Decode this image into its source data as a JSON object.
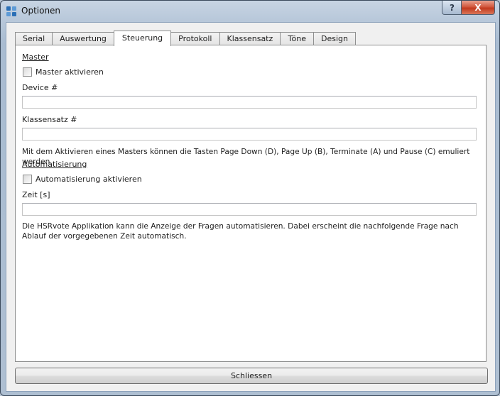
{
  "window": {
    "title": "Optionen",
    "help_symbol": "?",
    "close_symbol": "X"
  },
  "tabs": [
    {
      "label": "Serial"
    },
    {
      "label": "Auswertung"
    },
    {
      "label": "Steuerung"
    },
    {
      "label": "Protokoll"
    },
    {
      "label": "Klassensatz"
    },
    {
      "label": "Töne"
    },
    {
      "label": "Design"
    }
  ],
  "active_tab": "Steuerung",
  "master": {
    "section_title": "Master",
    "checkbox_label": "Master aktivieren",
    "checked": false,
    "device_label": "Device #",
    "device_value": "",
    "klassensatz_label": "Klassensatz #",
    "klassensatz_value": "",
    "description": "Mit dem Aktivieren eines Masters können die Tasten Page Down (D), Page Up (B), Terminate (A) und Pause (C) emuliert werden."
  },
  "automation": {
    "section_title": "Automatisierung",
    "checkbox_label": "Automatisierung aktivieren",
    "checked": false,
    "time_label": "Zeit [s]",
    "time_value": "",
    "description": "Die HSRvote Applikation kann die Anzeige der Fragen automatisieren. Dabei erscheint die nachfolgende Frage nach Ablauf der vorgegebenen Zeit automatisch."
  },
  "footer": {
    "close_label": "Schliessen"
  }
}
